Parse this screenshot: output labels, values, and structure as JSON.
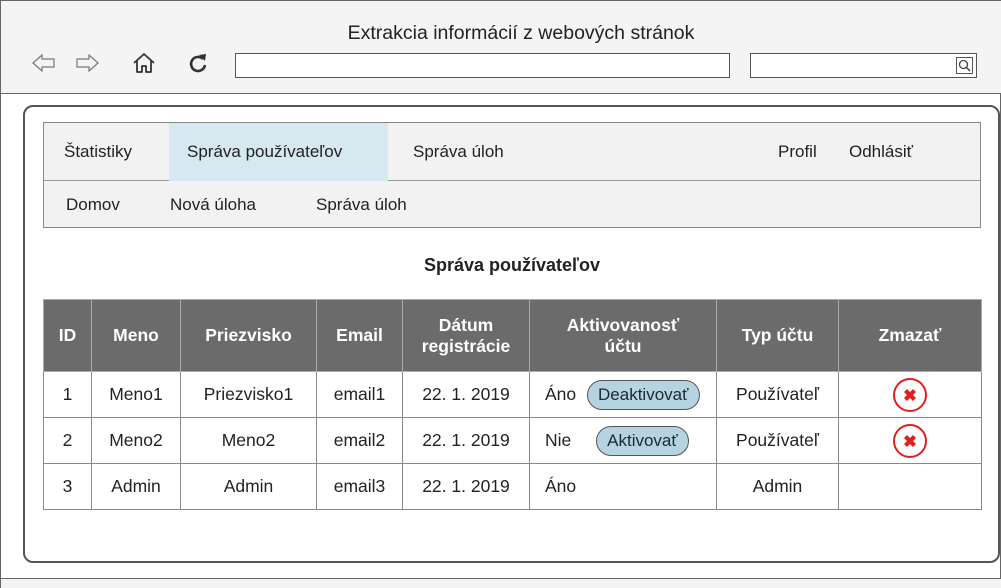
{
  "window": {
    "title": "Extrakcia informácií z webových stránok"
  },
  "browser": {
    "url_value": "",
    "search_value": "",
    "icons": [
      "back-arrow-icon",
      "forward-arrow-icon",
      "home-icon",
      "reload-icon",
      "search-icon"
    ]
  },
  "menu": {
    "main": [
      {
        "label": "Štatistiky",
        "active": false
      },
      {
        "label": "Správa používateľov",
        "active": true
      },
      {
        "label": "Správa úloh",
        "active": false
      },
      {
        "label": "Profil",
        "active": false
      },
      {
        "label": "Odhlásiť",
        "active": false
      }
    ],
    "sub": [
      {
        "label": "Domov"
      },
      {
        "label": "Nová úloha"
      },
      {
        "label": "Správa úloh"
      }
    ]
  },
  "page_title": "Správa používateľov",
  "table": {
    "headers": [
      "ID",
      "Meno",
      "Priezvisko",
      "Email",
      "Dátum registrácie",
      "Aktivovanosť účtu",
      "Typ účtu",
      "Zmazať"
    ],
    "header_lines": {
      "date": [
        "Dátum",
        "registrácie"
      ],
      "activation": [
        "Aktivovanosť",
        "účtu"
      ]
    },
    "rows": [
      {
        "id": "1",
        "first": "Meno1",
        "last": "Priezvisko1",
        "email": "email1",
        "date": "22. 1. 2019",
        "active": "Áno",
        "action": "Deaktivovať",
        "type": "Používateľ",
        "deletable": true
      },
      {
        "id": "2",
        "first": "Meno2",
        "last": "Meno2",
        "email": "email2",
        "date": "22. 1. 2019",
        "active": "Nie",
        "action": "Aktivovať",
        "type": "Používateľ",
        "deletable": true
      },
      {
        "id": "3",
        "first": "Admin",
        "last": "Admin",
        "email": "email3",
        "date": "22. 1. 2019",
        "active": "Áno",
        "action": "",
        "type": "Admin",
        "deletable": false
      }
    ]
  },
  "colors": {
    "header_bg": "#6b6b6b",
    "active_tab": "#d6e9f1",
    "pill_bg": "#b5d3e0",
    "delete_red": "#e01f1f"
  }
}
